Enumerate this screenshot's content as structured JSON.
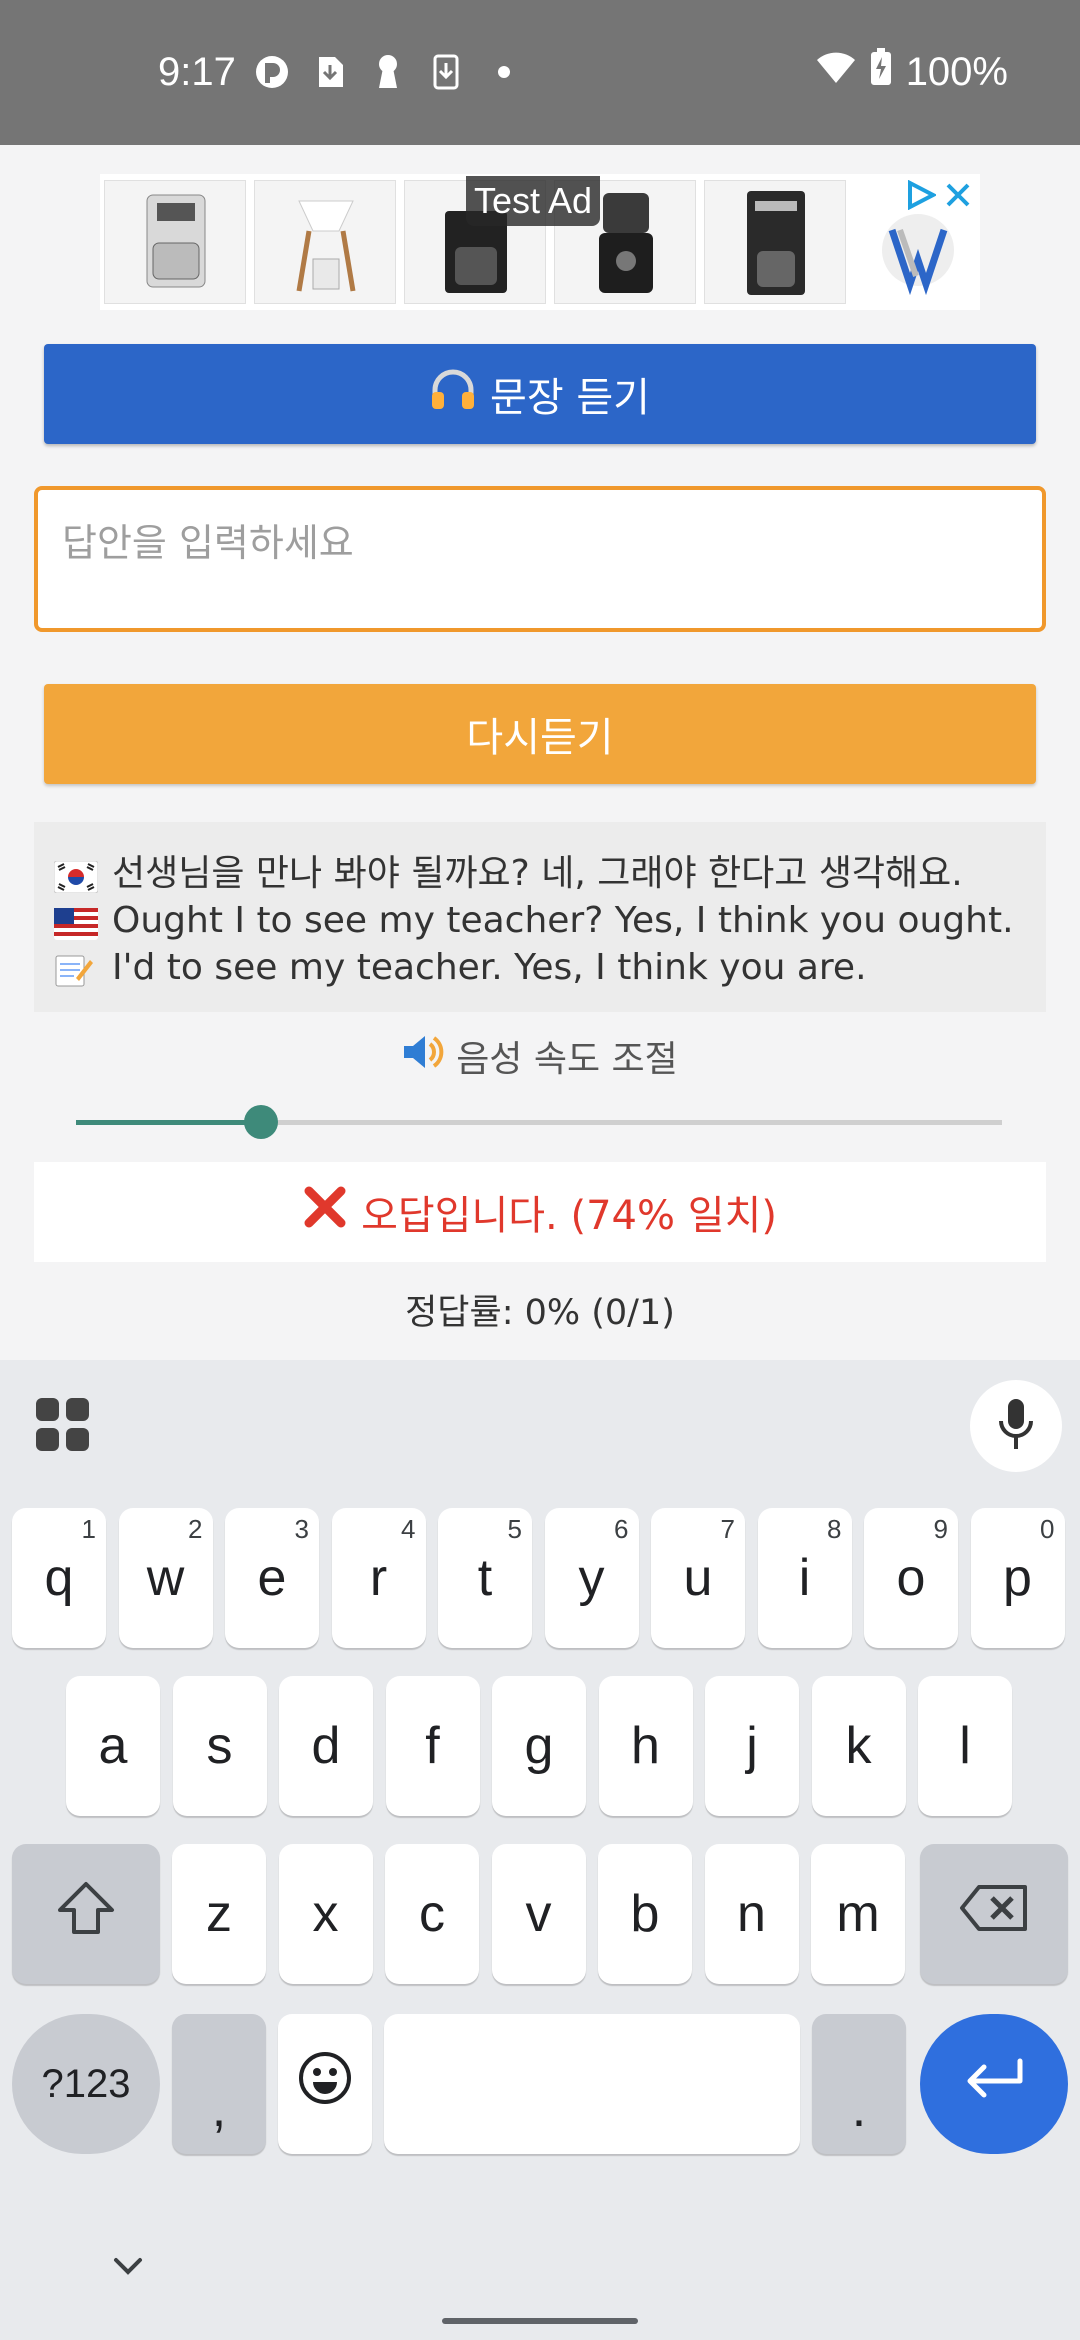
{
  "status_bar": {
    "time": "9:17",
    "battery": "100%",
    "left_icons": [
      "app-icon",
      "download-icon",
      "keyhole-icon",
      "download-box-icon",
      "dot-icon"
    ],
    "right_icons": [
      "wifi-icon",
      "battery-charging-icon"
    ]
  },
  "ad": {
    "label": "Test Ad",
    "products": [
      "coffee-maker-1",
      "pour-over-stand",
      "coffee-maker-2",
      "coffee-grinder",
      "coffee-maker-3"
    ],
    "brand_mark": "W"
  },
  "listen_button": {
    "icon": "headphones-icon",
    "label": "문장 듣기"
  },
  "answer_input": {
    "placeholder": "답안을 입력하세요",
    "value": ""
  },
  "replay_button": {
    "label": "다시듣기"
  },
  "sentences": [
    {
      "icon": "korea-flag-icon",
      "text": "선생님을 만나 봐야 될까요? 네, 그래야 한다고 생각해요."
    },
    {
      "icon": "us-flag-icon",
      "text": "Ought I to see my teacher? Yes, I think you ought."
    },
    {
      "icon": "memo-icon",
      "text": "I'd to see my teacher. Yes, I think you are."
    }
  ],
  "speed": {
    "icon": "speaker-icon",
    "label": "음성 속도 조절",
    "value_fraction": 0.2
  },
  "result": {
    "icon": "cross-mark-icon",
    "text": "오답입니다. (74% 일치)"
  },
  "score": {
    "text": "정답률: 0% (0/1)"
  },
  "keyboard": {
    "row1": [
      {
        "key": "q",
        "hint": "1"
      },
      {
        "key": "w",
        "hint": "2"
      },
      {
        "key": "e",
        "hint": "3"
      },
      {
        "key": "r",
        "hint": "4"
      },
      {
        "key": "t",
        "hint": "5"
      },
      {
        "key": "y",
        "hint": "6"
      },
      {
        "key": "u",
        "hint": "7"
      },
      {
        "key": "i",
        "hint": "8"
      },
      {
        "key": "o",
        "hint": "9"
      },
      {
        "key": "p",
        "hint": "0"
      }
    ],
    "row2": [
      "a",
      "s",
      "d",
      "f",
      "g",
      "h",
      "j",
      "k",
      "l"
    ],
    "row3": [
      "z",
      "x",
      "c",
      "v",
      "b",
      "n",
      "m"
    ],
    "symbols_label": "?123",
    "comma": ",",
    "period": "."
  }
}
